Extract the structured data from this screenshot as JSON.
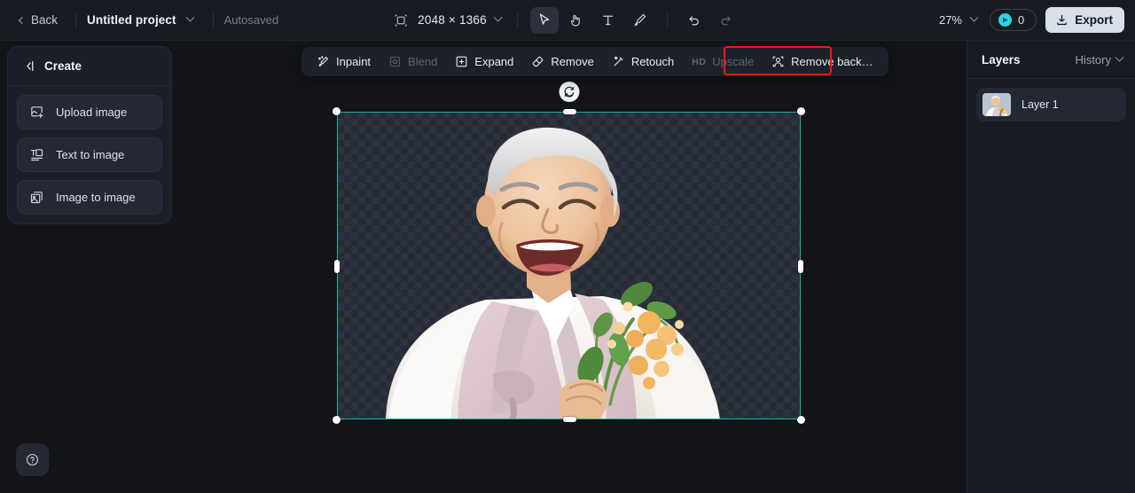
{
  "topbar": {
    "back_label": "Back",
    "project_name": "Untitled project",
    "autosave_label": "Autosaved",
    "canvas_size": "2048 × 1366",
    "canvas_size_icon": "canvas-resize-icon",
    "tools": [
      {
        "name": "select-tool",
        "icon": "cursor-arrow-icon",
        "active": true,
        "disabled": false
      },
      {
        "name": "hand-tool",
        "icon": "hand-icon",
        "active": false,
        "disabled": false
      },
      {
        "name": "text-tool",
        "icon": "text-T-icon",
        "active": false,
        "disabled": false
      },
      {
        "name": "brush-tool",
        "icon": "paintbrush-icon",
        "active": false,
        "disabled": false
      }
    ],
    "history": [
      {
        "name": "undo-button",
        "icon": "undo-arrow-icon",
        "disabled": false
      },
      {
        "name": "redo-button",
        "icon": "redo-arrow-icon",
        "disabled": true
      }
    ],
    "zoom_level": "27%",
    "credits_count": "0",
    "credits_icon": "coin-icon",
    "export_label": "Export",
    "export_icon": "download-icon"
  },
  "sidebar": {
    "title": "Create",
    "collapse_icon": "collapse-panel-icon",
    "items": [
      {
        "label": "Upload image",
        "icon": "upload-image-icon",
        "name": "sidebar-item-upload-image"
      },
      {
        "label": "Text to image",
        "icon": "text-to-image-icon",
        "name": "sidebar-item-text-to-image"
      },
      {
        "label": "Image to image",
        "icon": "image-to-image-icon",
        "name": "sidebar-item-image-to-image"
      }
    ],
    "help_icon": "help-question-icon"
  },
  "floating_toolbar": {
    "items": [
      {
        "label": "Inpaint",
        "icon": "inpaint-brush-icon",
        "disabled": false,
        "highlighted": false,
        "name": "inpaint-button"
      },
      {
        "label": "Blend",
        "icon": "blend-frame-icon",
        "disabled": true,
        "highlighted": false,
        "name": "blend-button"
      },
      {
        "label": "Expand",
        "icon": "expand-frame-icon",
        "disabled": false,
        "highlighted": false,
        "name": "expand-button"
      },
      {
        "label": "Remove",
        "icon": "eraser-icon",
        "disabled": false,
        "highlighted": false,
        "name": "remove-button"
      },
      {
        "label": "Retouch",
        "icon": "magic-wand-icon",
        "disabled": false,
        "highlighted": false,
        "name": "retouch-button"
      },
      {
        "label": "Upscale",
        "icon": "hd-badge-icon",
        "disabled": true,
        "highlighted": false,
        "name": "upscale-button",
        "prefix": "HD"
      },
      {
        "label": "Remove back…",
        "icon": "remove-background-icon",
        "disabled": false,
        "highlighted": true,
        "name": "remove-background-button"
      }
    ],
    "highlight_color": "#f91717"
  },
  "canvas": {
    "selection_color": "#14b8a6",
    "rotate_icon": "rotate-icon",
    "background": "transparent-checkerboard",
    "subject_description": "Smiling elderly man in white and lavender hanbok holding a bouquet of yellow flowers"
  },
  "right_panel": {
    "tab_layers": "Layers",
    "tab_history": "History",
    "history_caret_icon": "chevron-down-icon",
    "layers": [
      {
        "name": "Layer 1",
        "thumb": "layer-thumbnail"
      }
    ]
  }
}
